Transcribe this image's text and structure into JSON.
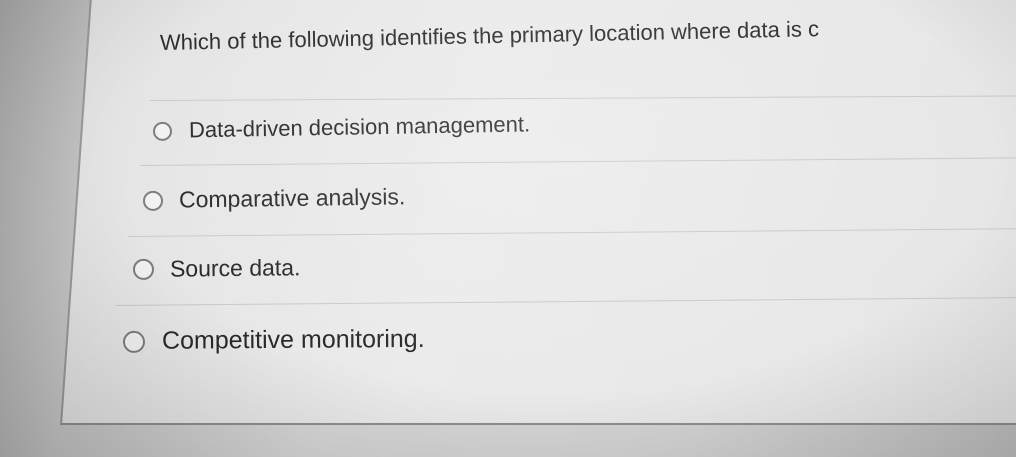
{
  "question": {
    "text": "Which of the following identifies the primary location where data is c"
  },
  "options": [
    {
      "label": "Data-driven decision management."
    },
    {
      "label": "Comparative analysis."
    },
    {
      "label": "Source data."
    },
    {
      "label": "Competitive monitoring."
    }
  ]
}
